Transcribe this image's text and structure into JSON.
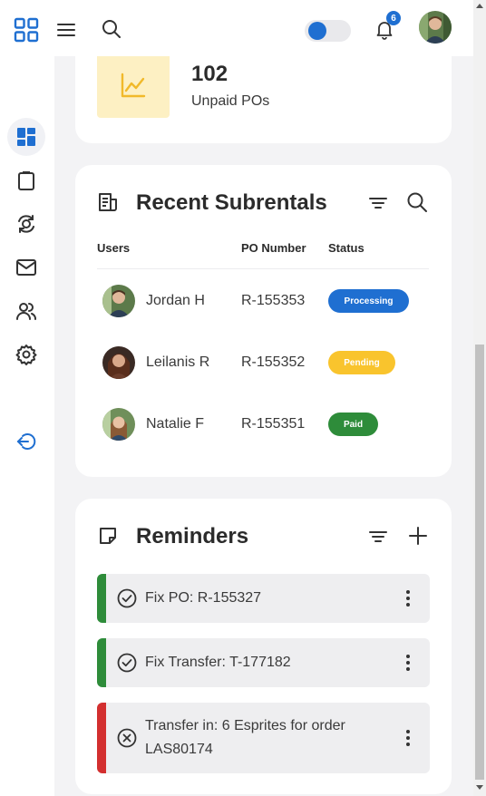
{
  "topbar": {
    "icons": [
      "apps-grid-icon",
      "menu-icon",
      "search-icon"
    ],
    "notifications_count": "6",
    "theme_toggle": "dark-mode-toggle"
  },
  "sidebar": {
    "items": [
      {
        "icon": "dashboard-icon",
        "active": true
      },
      {
        "icon": "clipboard-icon"
      },
      {
        "icon": "subrental-icon"
      },
      {
        "icon": "mail-icon"
      },
      {
        "icon": "users-icon"
      },
      {
        "icon": "settings-icon"
      },
      {
        "icon": "logout-icon"
      }
    ]
  },
  "stat_card": {
    "value": "102",
    "label": "Unpaid POs",
    "icon": "trend-chart-icon"
  },
  "subrentals": {
    "title": "Recent Subrentals",
    "columns": {
      "users": "Users",
      "po_number": "PO Number",
      "status": "Status"
    },
    "rows": [
      {
        "name": "Jordan H",
        "po": "R-155353",
        "status": "Processing",
        "color": "#1f6fd1"
      },
      {
        "name": "Leilanis R",
        "po": "R-155352",
        "status": "Pending",
        "color": "#f9c42d"
      },
      {
        "name": "Natalie F",
        "po": "R-155351",
        "status": "Paid",
        "color": "#2e8c3a"
      }
    ]
  },
  "reminders": {
    "title": "Reminders",
    "items": [
      {
        "text": "Fix PO: R-155327",
        "state": "done",
        "color": "#2e8c3a"
      },
      {
        "text": "Fix Transfer: T-177182",
        "state": "done",
        "color": "#2e8c3a"
      },
      {
        "text": "Transfer in: 6 Esprites for order LAS80174",
        "state": "cancelled",
        "color": "#d32f2f"
      }
    ]
  }
}
